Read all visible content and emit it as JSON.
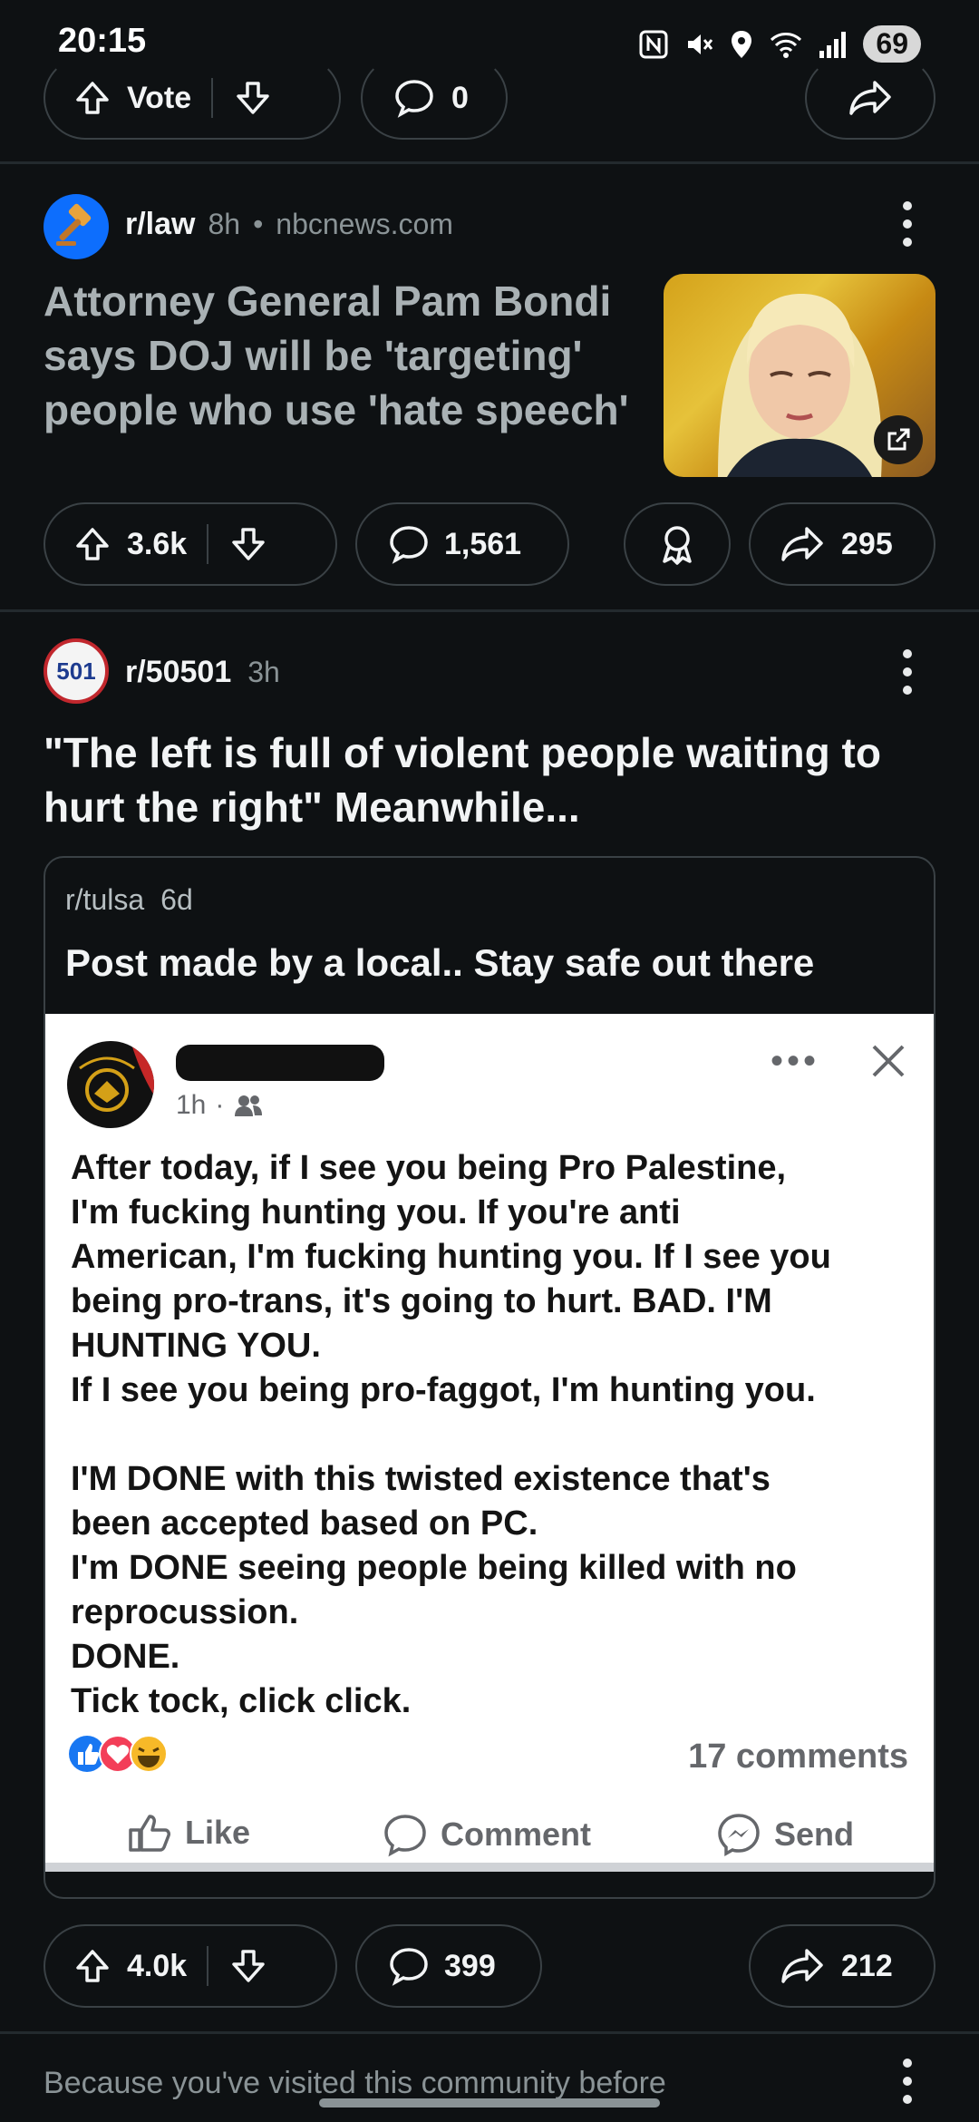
{
  "status_bar": {
    "time": "20:15",
    "battery": "69"
  },
  "prev_post": {
    "vote_label": "Vote",
    "comments": "0"
  },
  "post1": {
    "subreddit": "r/law",
    "age": "8h",
    "domain": "nbcnews.com",
    "title": "Attorney General Pam Bondi says DOJ will be 'targeting' people who use 'hate speech'",
    "upvotes": "3.6k",
    "comments": "1,561",
    "shares": "295"
  },
  "post2": {
    "subreddit": "r/50501",
    "avatar_text": "501",
    "age": "3h",
    "title": "\"The left is full of violent people waiting to hurt the right\" Meanwhile...",
    "crosspost": {
      "subreddit": "r/tulsa",
      "age": "6d",
      "title": "Post made by a local.. Stay safe out there",
      "fb": {
        "time": "1h",
        "text": "After today, if I see you being Pro Palestine,\nI'm fucking hunting you. If you're anti\nAmerican, I'm fucking hunting you. If I see you\nbeing pro-trans, it's going to hurt. BAD. I'M\nHUNTING YOU.\nIf I see you being pro-faggot, I'm hunting you.\n\nI'M DONE with this twisted existence that's\nbeen accepted based on PC.\nI'm DONE seeing people being killed with no\nreprocussion.\nDONE.\nTick tock, click click.",
        "comments": "17 comments",
        "like": "Like",
        "comment": "Comment",
        "send": "Send"
      }
    },
    "upvotes": "4.0k",
    "comments": "399",
    "shares": "212"
  },
  "footer": {
    "recommendation": "Because you've visited this community before"
  },
  "colors": {
    "background": "#0e1113",
    "border": "#3a4145",
    "law_avatar": "#0d6efd",
    "fb_like": "#1877f2",
    "fb_love": "#f33e58"
  }
}
